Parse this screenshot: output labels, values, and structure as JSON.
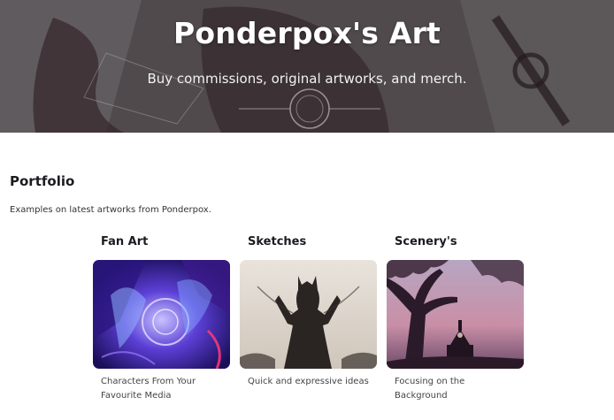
{
  "hero": {
    "title": "Ponderpox's Art",
    "subtitle": "Buy commissions, original artworks, and merch."
  },
  "portfolio": {
    "title": "Portfolio",
    "description": "Examples on latest artworks from Ponderpox.",
    "cards": [
      {
        "title": "Fan Art",
        "caption": "Characters From Your Favourite Media",
        "image": "fan-art-image"
      },
      {
        "title": "Sketches",
        "caption": "Quick and expressive ideas",
        "image": "sketches-image"
      },
      {
        "title": "Scenery's",
        "caption": "Focusing on the Background",
        "image": "scenery-image"
      }
    ]
  }
}
